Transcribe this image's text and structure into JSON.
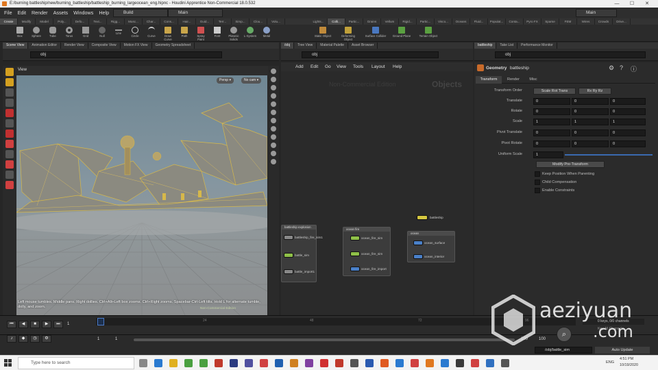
{
  "window": {
    "title": "E:/burning battleship/new/burning_battleship/battleship_burning_largeocean_eng.hipnc - Houdini Apprentice Non-Commercial 18.0.532",
    "minimize": "—",
    "maximize": "☐",
    "close": "✕"
  },
  "menu": {
    "items": [
      "File",
      "Edit",
      "Render",
      "Assets",
      "Windows",
      "Help"
    ],
    "desktop_build": "Build",
    "desktop_main": "Main",
    "right_main": "Main"
  },
  "shelf_tabs": [
    "Create",
    "Modify",
    "Model",
    "Poly...",
    "Defo...",
    "Text...",
    "Rigg...",
    "Musc...",
    "Char...",
    "Cons...",
    "Hair...",
    "Guid...",
    "Terr...",
    "Simp...",
    "Clou...",
    "Volu...",
    "Lights...",
    "Colli...",
    "Partic...",
    "Grains",
    "Vellum",
    "Rigid...",
    "Partic...",
    "Visco...",
    "Oceans",
    "Fluid...",
    "Populat...",
    "Conta...",
    "Pyro FX",
    "Sparse",
    "FEM",
    "Wires",
    "Crowds",
    "Drive..."
  ],
  "shelf_tools": [
    "Box",
    "Sphere",
    "Tube",
    "Torus",
    "Grid",
    "Null",
    "Line",
    "Circle",
    "Curve",
    "Draw Curve",
    "Path",
    "Spray Paint",
    "Font",
    "Platonic Solids",
    "L-System",
    "Metal"
  ],
  "right_shelf_tools": [
    "Static Object",
    "Deforming Object",
    "Surface Collider",
    "Ground Plane",
    "Terrain Object"
  ],
  "left_pane": {
    "tabs": [
      "Scene View",
      "Animation Editor",
      "Render View",
      "Composite View",
      "Motion FX View",
      "Geometry Spreadsheet"
    ],
    "path": "obj",
    "view_label": "View",
    "persp": "Persp ▾",
    "cam": "No cam ▾",
    "hint": "Left mouse tumbles. Middle pans. Right dollies. Ctrl+Alt+Left box zooms. Ctrl+Right zooms. Spacebar-Ctrl-Left tilts. Hold L for alternate tumble, dolly, and zoom.",
    "watermark_small": "Non-Commercial Edition"
  },
  "network": {
    "tabs": [
      "/obj",
      "Tree View",
      "Material Palette",
      "Asset Browser"
    ],
    "path": "obj",
    "menu": [
      "Add",
      "Edit",
      "Go",
      "View",
      "Tools",
      "Layout",
      "Help"
    ],
    "bg_text": "Non-Commercial Edition",
    "context": "Objects",
    "boxes": [
      {
        "title": "battleship explosion",
        "nodes": [
          "battleship_fire_sim1",
          "battle_sim",
          "battle_import1"
        ]
      },
      {
        "title": "ocean fire",
        "nodes": [
          "ocean_fire_sim",
          "ocean_fire_sim",
          "ocean_fire_import"
        ]
      },
      {
        "title": "ocean",
        "nodes": [
          "ocean_surface",
          "ocean_interior"
        ]
      }
    ],
    "lone_node": "battleship"
  },
  "params": {
    "tabs": [
      "battleship",
      "Take List",
      "Performance Monitor"
    ],
    "path": "obj",
    "node_type": "Geometry",
    "node_name": "battleship",
    "sub_tabs": [
      "Transform",
      "Render",
      "Misc"
    ],
    "transform_order_label": "Transform Order",
    "transform_order": "Scale Rot Trans",
    "rot_order": "Rx Ry Rz",
    "rows": [
      {
        "label": "Translate",
        "values": [
          "0",
          "0",
          "0"
        ]
      },
      {
        "label": "Rotate",
        "values": [
          "0",
          "0",
          "0"
        ]
      },
      {
        "label": "Scale",
        "values": [
          "1",
          "1",
          "1"
        ]
      },
      {
        "label": "Pivot Translate",
        "values": [
          "0",
          "0",
          "0"
        ]
      },
      {
        "label": "Pivot Rotate",
        "values": [
          "0",
          "0",
          "0"
        ]
      }
    ],
    "uniform_scale_label": "Uniform Scale",
    "uniform_scale": "1",
    "modify_button": "Modify Pre-Transform",
    "checkboxes": [
      "Keep Position When Parenting",
      "Child Compensation",
      "Enable Constraints"
    ]
  },
  "timeline": {
    "current_frame": "1",
    "ticks": [
      "1",
      "24",
      "48",
      "72",
      "96",
      "120"
    ],
    "start": "1",
    "start2": "1",
    "end": "100",
    "end2": "100",
    "keys": "0 keys, 0/0 channels",
    "key_all": "Key All Channels"
  },
  "status": {
    "path": "/obj/battle_sim",
    "auto_update": "Auto Update"
  },
  "taskbar": {
    "search": "Type here to search",
    "lang": "ENG",
    "time": "4:51 PM",
    "date": "10/19/2020"
  },
  "brand": {
    "name": "aeziyuan",
    "domain": ".com"
  }
}
